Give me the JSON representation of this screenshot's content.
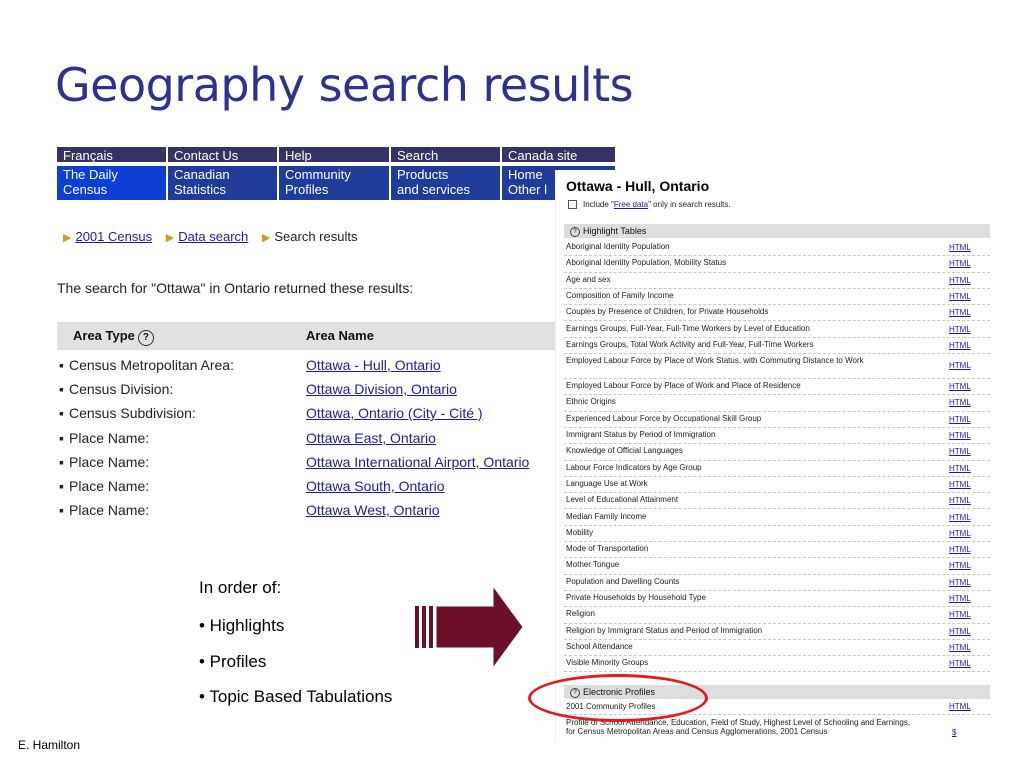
{
  "slide": {
    "title": "Geography search results",
    "footer": "E. Hamilton",
    "bullets": {
      "intro": "In order of:",
      "items": [
        "• Highlights",
        "• Profiles",
        "• Topic Based Tabulations"
      ]
    }
  },
  "left_screenshot": {
    "nav": {
      "row1": [
        "Français",
        "Contact Us",
        "Help",
        "Search",
        "Canada site"
      ],
      "row2": [
        {
          "line1": "The Daily",
          "line2": "Census"
        },
        {
          "line1": "Canadian",
          "line2": "Statistics"
        },
        {
          "line1": "Community",
          "line2": "Profiles"
        },
        {
          "line1": "Products",
          "line2": "and services"
        },
        {
          "line1": "Home",
          "line2": "Other l"
        }
      ]
    },
    "breadcrumb": [
      "2001 Census",
      "Data search",
      "Search results"
    ],
    "search_message": "The search for \"Ottawa\" in Ontario returned these results:",
    "table": {
      "col_type": "Area Type",
      "col_name": "Area Name",
      "rows": [
        {
          "type": "Census Metropolitan Area:",
          "name": "Ottawa - Hull, Ontario"
        },
        {
          "type": "Census Division:",
          "name": "Ottawa Division, Ontario"
        },
        {
          "type": "Census Subdivision:",
          "name": "Ottawa, Ontario (City - Cité )"
        },
        {
          "type": "Place Name:",
          "name": "Ottawa East, Ontario"
        },
        {
          "type": "Place Name:",
          "name": "Ottawa International Airport, Ontario"
        },
        {
          "type": "Place Name:",
          "name": "Ottawa South, Ontario"
        },
        {
          "type": "Place Name:",
          "name": "Ottawa West, Ontario"
        }
      ]
    }
  },
  "right_screenshot": {
    "title": "Ottawa - Hull, Ontario",
    "include_pre": "Include \"",
    "include_link": "Free data",
    "include_post": "\" only in search results.",
    "highlight_header": "Highlight Tables",
    "highlight_rows": [
      {
        "label": "Aboriginal Identity Population",
        "link": "HTML"
      },
      {
        "label": "Aboriginal Identity Population, Mobility Status",
        "link": "HTML"
      },
      {
        "label": "Age and sex",
        "link": "HTML"
      },
      {
        "label": "Composition of Family Income",
        "link": "HTML"
      },
      {
        "label": "Couples by Presence of Children, for Private Households",
        "link": "HTML"
      },
      {
        "label": "Earnings Groups, Full-Year, Full-Time Workers by Level of Education",
        "link": "HTML"
      },
      {
        "label": "Earnings Groups, Total Work Activity and Full-Year, Full-Time Workers",
        "link": "HTML"
      },
      {
        "label": "Employed Labour Force by Place of Work Status, with Commuting Distance to Work",
        "link": "HTML"
      },
      {
        "label": "Employed Labour Force by Place of Work and Place of Residence",
        "link": "HTML"
      },
      {
        "label": "Ethnic Origins",
        "link": "HTML"
      },
      {
        "label": "Experienced Labour Force by Occupational Skill Group",
        "link": "HTML"
      },
      {
        "label": "Immigrant Status by Period of Immigration",
        "link": "HTML"
      },
      {
        "label": "Knowledge of Official Languages",
        "link": "HTML"
      },
      {
        "label": "Labour Force Indicators by Age Group",
        "link": "HTML"
      },
      {
        "label": "Language Use at Work",
        "link": "HTML"
      },
      {
        "label": "Level of Educational Attainment",
        "link": "HTML"
      },
      {
        "label": "Median Family Income",
        "link": "HTML"
      },
      {
        "label": "Mobility",
        "link": "HTML"
      },
      {
        "label": "Mode of Transportation",
        "link": "HTML"
      },
      {
        "label": "Mother Tongue",
        "link": "HTML"
      },
      {
        "label": "Population and Dwelling Counts",
        "link": "HTML"
      },
      {
        "label": "Private Households by Household Type",
        "link": "HTML"
      },
      {
        "label": "Religion",
        "link": "HTML"
      },
      {
        "label": "Religion by Immigrant Status and Period of Immigration",
        "link": "HTML"
      },
      {
        "label": "School Attendance",
        "link": "HTML"
      },
      {
        "label": "Visible Minority Groups",
        "link": "HTML"
      }
    ],
    "profiles_header": "Electronic Profiles",
    "profile_rows": [
      {
        "label": "2001 Community Profiles",
        "link": "HTML"
      },
      {
        "label": "Profile of School Attendance, Education, Field of Study, Highest Level of Schooling and Earnings, for Census Metropolitan Areas and Census Agglomerations, 2001 Census",
        "link": "$"
      }
    ]
  },
  "colors": {
    "title": "#2e3192",
    "nav_blue": "#1f3c9b",
    "link": "#1c1ca8",
    "arrow": "#6b0f2a",
    "highlight_ring": "#e21b1b"
  }
}
